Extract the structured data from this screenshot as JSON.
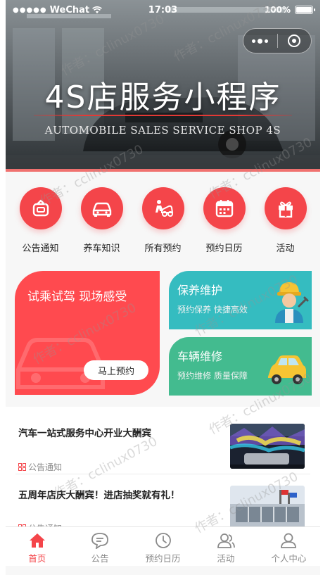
{
  "status_bar": {
    "carrier": "WeChat",
    "time": "17:03",
    "battery": "100%"
  },
  "banner": {
    "title": "4S店服务小程序",
    "subtitle": "AUTOMOBILE SALES SERVICE SHOP 4S"
  },
  "nav": {
    "items": [
      {
        "label": "公告通知",
        "icon": "notice-icon"
      },
      {
        "label": "养车知识",
        "icon": "car-icon"
      },
      {
        "label": "所有预约",
        "icon": "repair-icon"
      },
      {
        "label": "预约日历",
        "icon": "calendar-icon"
      },
      {
        "label": "活动",
        "icon": "gift-icon"
      }
    ]
  },
  "promo": {
    "test_drive": {
      "title": "试乘试驾 现场感受",
      "button": "马上预约"
    },
    "maintenance": {
      "title": "保养维护",
      "subtitle": "预约保养 快捷高效"
    },
    "repair": {
      "title": "车辆维修",
      "subtitle": "预约维修 质量保障"
    }
  },
  "news": {
    "items": [
      {
        "title": "汽车一站式服务中心开业大酬宾",
        "tag": "公告通知"
      },
      {
        "title": "五周年店庆大酬宾！进店抽奖就有礼！",
        "tag": "公告通知"
      }
    ]
  },
  "tabbar": {
    "items": [
      {
        "label": "首页",
        "active": true
      },
      {
        "label": "公告",
        "active": false
      },
      {
        "label": "预约日历",
        "active": false
      },
      {
        "label": "活动",
        "active": false
      },
      {
        "label": "个人中心",
        "active": false
      }
    ]
  },
  "watermark": "作者：cclinux0730",
  "colors": {
    "accent": "#f4454a",
    "teal": "#35bcc0",
    "green": "#43bb8f"
  }
}
